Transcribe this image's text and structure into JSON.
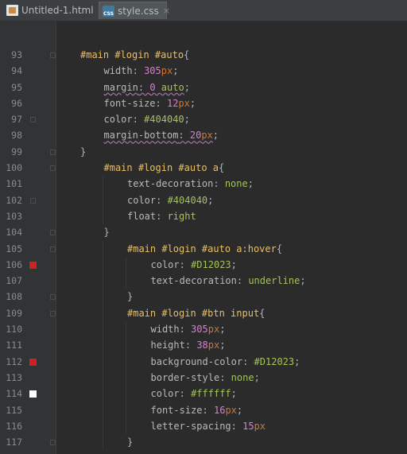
{
  "tabs": [
    {
      "label": "Untitled-1.html",
      "icon": "html-file-icon",
      "close": "×",
      "active": false
    },
    {
      "label": "style.css",
      "icon": "css-file-icon",
      "icon_text": "CSS",
      "close": "×",
      "active": true
    }
  ],
  "colors": {
    "background": "#2b2b2b",
    "gutter": "#313335",
    "selector": "#e8bf6a",
    "property": "#bababa",
    "number": "#d87fd1",
    "value": "#a5c25c",
    "swatch_red": "#D12023",
    "swatch_white": "#ffffff"
  },
  "editor": {
    "lines": [
      {
        "num": "93",
        "indent": 0,
        "tokens": [
          [
            "sel",
            "#main #login #auto"
          ],
          [
            "punc",
            "{"
          ]
        ]
      },
      {
        "num": "94",
        "indent": 1,
        "tokens": [
          [
            "prop",
            "width"
          ],
          [
            "punc",
            ": "
          ],
          [
            "num",
            "305"
          ],
          [
            "kw",
            "px"
          ],
          [
            "punc",
            ";"
          ]
        ]
      },
      {
        "num": "95",
        "indent": 1,
        "squiggle": true,
        "tokens": [
          [
            "prop",
            "margin"
          ],
          [
            "punc",
            ": "
          ],
          [
            "num",
            "0"
          ],
          [
            "punc",
            " "
          ],
          [
            "val",
            "auto"
          ],
          [
            "punc",
            ";"
          ]
        ]
      },
      {
        "num": "96",
        "indent": 1,
        "tokens": [
          [
            "prop",
            "font-size"
          ],
          [
            "punc",
            ": "
          ],
          [
            "num",
            "12"
          ],
          [
            "kw",
            "px"
          ],
          [
            "punc",
            ";"
          ]
        ]
      },
      {
        "num": "97",
        "indent": 1,
        "tokens": [
          [
            "prop",
            "color"
          ],
          [
            "punc",
            ": "
          ],
          [
            "val",
            "#404040"
          ],
          [
            "punc",
            ";"
          ]
        ]
      },
      {
        "num": "98",
        "indent": 1,
        "squiggle": true,
        "tokens": [
          [
            "prop",
            "margin-bottom"
          ],
          [
            "punc",
            ": "
          ],
          [
            "num",
            "20"
          ],
          [
            "kw",
            "px"
          ],
          [
            "punc",
            ";"
          ]
        ]
      },
      {
        "num": "99",
        "indent": 0,
        "tokens": [
          [
            "punc",
            "}"
          ]
        ]
      },
      {
        "num": "100",
        "indent": 1,
        "tokens": [
          [
            "sel",
            "#main #login #auto a"
          ],
          [
            "punc",
            "{"
          ]
        ]
      },
      {
        "num": "101",
        "indent": 2,
        "tokens": [
          [
            "prop",
            "text-decoration"
          ],
          [
            "punc",
            ": "
          ],
          [
            "val",
            "none"
          ],
          [
            "punc",
            ";"
          ]
        ]
      },
      {
        "num": "102",
        "indent": 2,
        "tokens": [
          [
            "prop",
            "color"
          ],
          [
            "punc",
            ": "
          ],
          [
            "val",
            "#404040"
          ],
          [
            "punc",
            ";"
          ]
        ]
      },
      {
        "num": "103",
        "indent": 2,
        "tokens": [
          [
            "prop",
            "float"
          ],
          [
            "punc",
            ": "
          ],
          [
            "val",
            "right"
          ]
        ]
      },
      {
        "num": "104",
        "indent": 1,
        "tokens": [
          [
            "punc",
            "}"
          ]
        ]
      },
      {
        "num": "105",
        "indent": 2,
        "tokens": [
          [
            "sel",
            "#main #login #auto a:hover"
          ],
          [
            "punc",
            "{"
          ]
        ]
      },
      {
        "num": "106",
        "indent": 3,
        "swatch": "#D12023",
        "tokens": [
          [
            "prop",
            "color"
          ],
          [
            "punc",
            ": "
          ],
          [
            "val",
            "#D12023"
          ],
          [
            "punc",
            ";"
          ]
        ]
      },
      {
        "num": "107",
        "indent": 3,
        "tokens": [
          [
            "prop",
            "text-decoration"
          ],
          [
            "punc",
            ": "
          ],
          [
            "val",
            "underline"
          ],
          [
            "punc",
            ";"
          ]
        ]
      },
      {
        "num": "108",
        "indent": 2,
        "tokens": [
          [
            "punc",
            "}"
          ]
        ]
      },
      {
        "num": "109",
        "indent": 2,
        "tokens": [
          [
            "sel",
            "#main #login #btn input"
          ],
          [
            "punc",
            "{"
          ]
        ]
      },
      {
        "num": "110",
        "indent": 3,
        "tokens": [
          [
            "prop",
            "width"
          ],
          [
            "punc",
            ": "
          ],
          [
            "num",
            "305"
          ],
          [
            "kw",
            "px"
          ],
          [
            "punc",
            ";"
          ]
        ]
      },
      {
        "num": "111",
        "indent": 3,
        "tokens": [
          [
            "prop",
            "height"
          ],
          [
            "punc",
            ": "
          ],
          [
            "num",
            "38"
          ],
          [
            "kw",
            "px"
          ],
          [
            "punc",
            ";"
          ]
        ]
      },
      {
        "num": "112",
        "indent": 3,
        "swatch": "#D12023",
        "tokens": [
          [
            "prop",
            "background-color"
          ],
          [
            "punc",
            ": "
          ],
          [
            "val",
            "#D12023"
          ],
          [
            "punc",
            ";"
          ]
        ]
      },
      {
        "num": "113",
        "indent": 3,
        "tokens": [
          [
            "prop",
            "border-style"
          ],
          [
            "punc",
            ": "
          ],
          [
            "val",
            "none"
          ],
          [
            "punc",
            ";"
          ]
        ]
      },
      {
        "num": "114",
        "indent": 3,
        "swatch": "#ffffff",
        "tokens": [
          [
            "prop",
            "color"
          ],
          [
            "punc",
            ": "
          ],
          [
            "val",
            "#ffffff"
          ],
          [
            "punc",
            ";"
          ]
        ]
      },
      {
        "num": "115",
        "indent": 3,
        "tokens": [
          [
            "prop",
            "font-size"
          ],
          [
            "punc",
            ": "
          ],
          [
            "num",
            "16"
          ],
          [
            "kw",
            "px"
          ],
          [
            "punc",
            ";"
          ]
        ]
      },
      {
        "num": "116",
        "indent": 3,
        "tokens": [
          [
            "prop",
            "letter-spacing"
          ],
          [
            "punc",
            ": "
          ],
          [
            "num",
            "15"
          ],
          [
            "kw",
            "px"
          ]
        ]
      },
      {
        "num": "117",
        "indent": 2,
        "tokens": [
          [
            "punc",
            "}"
          ]
        ]
      }
    ]
  }
}
